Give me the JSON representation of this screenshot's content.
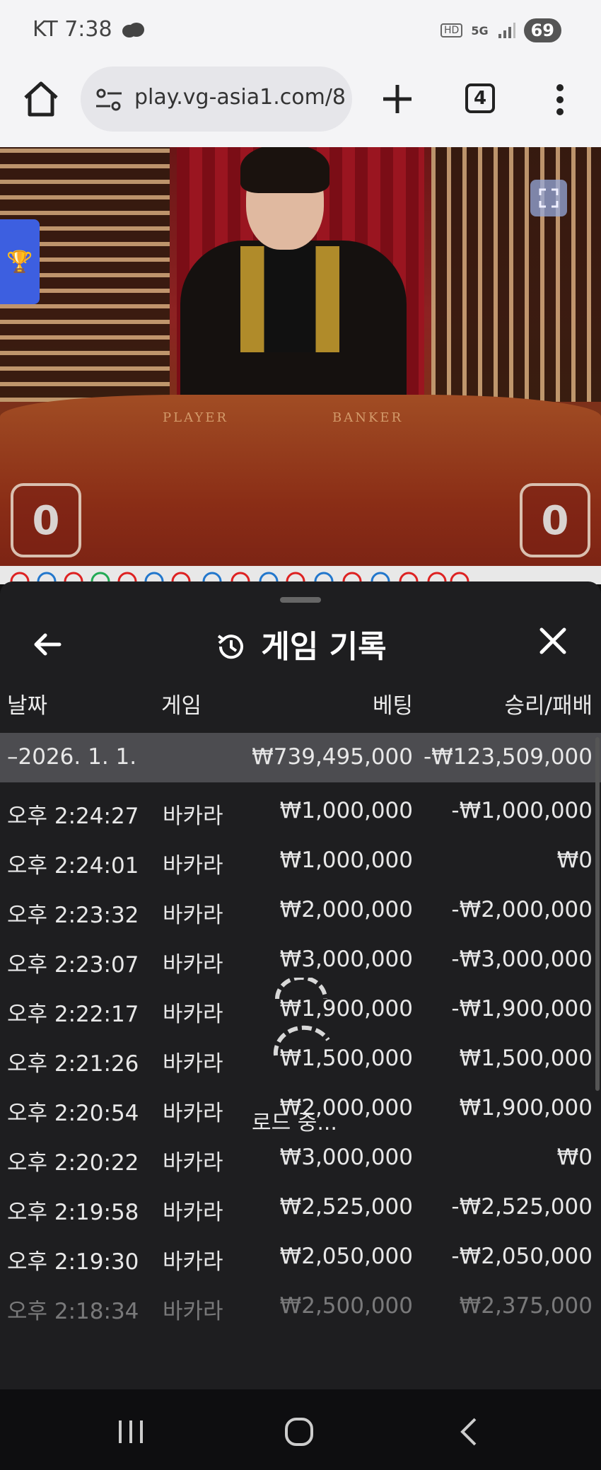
{
  "status": {
    "carrier_time": "KT 7:38",
    "battery": "69"
  },
  "browser": {
    "url": "play.vg-asia1.com/8",
    "tab_count": "4"
  },
  "video": {
    "player_label": "PLAYER",
    "banker_label": "BANKER",
    "player_score": "0",
    "banker_score": "0"
  },
  "history": {
    "title": "게임 기록",
    "columns": {
      "date": "날짜",
      "game": "게임",
      "bet": "베팅",
      "result": "승리/패배"
    },
    "summary": {
      "date": "–2026. 1. 1.",
      "bet": "₩739,495,000",
      "result": "-₩123,509,000"
    },
    "rows": [
      {
        "date": "오후 2:24:27",
        "game": "바카라",
        "bet": "₩1,000,000",
        "result": "-₩1,000,000"
      },
      {
        "date": "오후 2:24:01",
        "game": "바카라",
        "bet": "₩1,000,000",
        "result": "₩0"
      },
      {
        "date": "오후 2:23:32",
        "game": "바카라",
        "bet": "₩2,000,000",
        "result": "-₩2,000,000"
      },
      {
        "date": "오후 2:23:07",
        "game": "바카라",
        "bet": "₩3,000,000",
        "result": "-₩3,000,000"
      },
      {
        "date": "오후 2:22:17",
        "game": "바카라",
        "bet": "₩1,900,000",
        "result": "-₩1,900,000"
      },
      {
        "date": "오후 2:21:26",
        "game": "바카라",
        "bet": "₩1,500,000",
        "result": "₩1,500,000"
      },
      {
        "date": "오후 2:20:54",
        "game": "바카라",
        "bet": "₩2,000,000",
        "result": "₩1,900,000"
      },
      {
        "date": "오후 2:20:22",
        "game": "바카라",
        "bet": "₩3,000,000",
        "result": "₩0"
      },
      {
        "date": "오후 2:19:58",
        "game": "바카라",
        "bet": "₩2,525,000",
        "result": "-₩2,525,000"
      },
      {
        "date": "오후 2:19:30",
        "game": "바카라",
        "bet": "₩2,050,000",
        "result": "-₩2,050,000"
      },
      {
        "date": "오후 2:18:34",
        "game": "바카라",
        "bet": "₩2,500,000",
        "result": "₩2,375,000"
      }
    ],
    "loading_text": "로드 중..."
  }
}
